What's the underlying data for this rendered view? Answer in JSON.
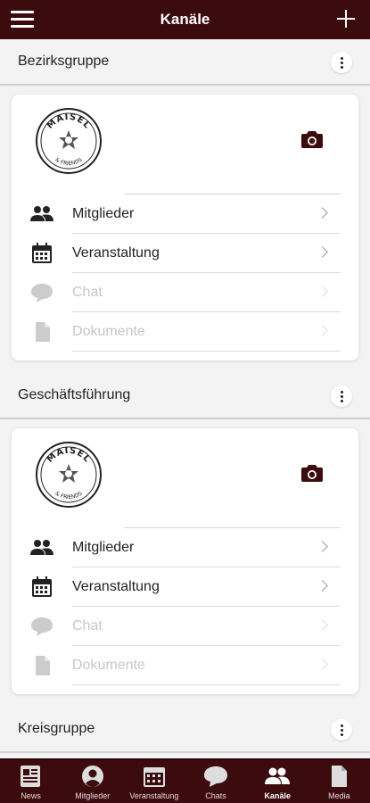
{
  "topbar": {
    "title": "Kanäle"
  },
  "groups": [
    {
      "name": "Bezirksgruppe",
      "rows": [
        "Mitglieder",
        "Veranstaltung",
        "Chat",
        "Dokumente"
      ]
    },
    {
      "name": "Geschäftsführung",
      "rows": [
        "Mitglieder",
        "Veranstaltung",
        "Chat",
        "Dokumente"
      ]
    },
    {
      "name": "Kreisgruppe"
    }
  ],
  "logo": {
    "top_text": "MAISEL",
    "bottom_text": "& FRIENDS"
  },
  "bottom_nav": [
    {
      "label": "News",
      "icon": "news-icon"
    },
    {
      "label": "Mitglieder",
      "icon": "account-circle-icon"
    },
    {
      "label": "Veranstaltung",
      "icon": "calendar-icon"
    },
    {
      "label": "Chats",
      "icon": "chat-bubble-icon"
    },
    {
      "label": "Kanäle",
      "icon": "group-icon",
      "active": true
    },
    {
      "label": "Media",
      "icon": "document-icon"
    }
  ],
  "colors": {
    "brand": "#3c0b0e",
    "disabled": "#c7c7c7"
  }
}
